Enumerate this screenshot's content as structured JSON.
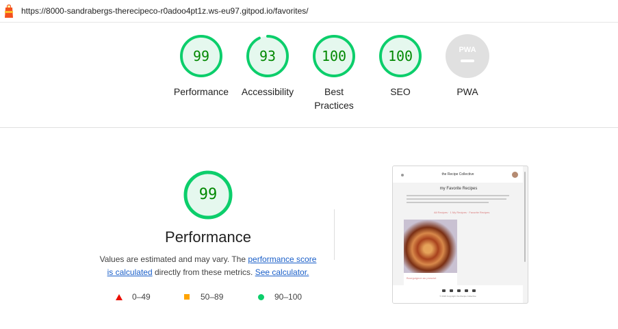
{
  "url": "https://8000-sandrabergs-therecipeco-r0adoo4pt1z.ws-eu97.gitpod.io/favorites/",
  "gauges": [
    {
      "score": "99",
      "label": "Performance",
      "value": 0.99
    },
    {
      "score": "93",
      "label": "Accessibility",
      "value": 0.93
    },
    {
      "score": "100",
      "label": "Best\nPractices",
      "value": 1.0
    },
    {
      "score": "100",
      "label": "SEO",
      "value": 1.0
    },
    {
      "score": "",
      "label": "PWA",
      "badge": "PWA"
    }
  ],
  "main": {
    "score": "99",
    "title": "Performance",
    "desc_prefix": "Values are estimated and may vary. The ",
    "link1": "performance score is calculated",
    "desc_mid": " directly from these metrics. ",
    "link2": "See calculator."
  },
  "legend": {
    "fail": "0–49",
    "average": "50–89",
    "pass": "90–100"
  },
  "colors": {
    "pass": "#0cce6b",
    "pass_text": "#008800",
    "pass_fill": "#e5f8ee",
    "average": "#ffa400",
    "fail": "#eb0f00",
    "link": "#1a5fc9"
  },
  "preview": {
    "brand": "the Recipe Collective",
    "title": "my Favorite Recipes",
    "filters": "All Recipes · 1 My Recipes · Favorite Recipes",
    "card_title": "Bourguignon au prosciut",
    "copyright": "© 2023 Copyright: the Recipe Collective"
  }
}
